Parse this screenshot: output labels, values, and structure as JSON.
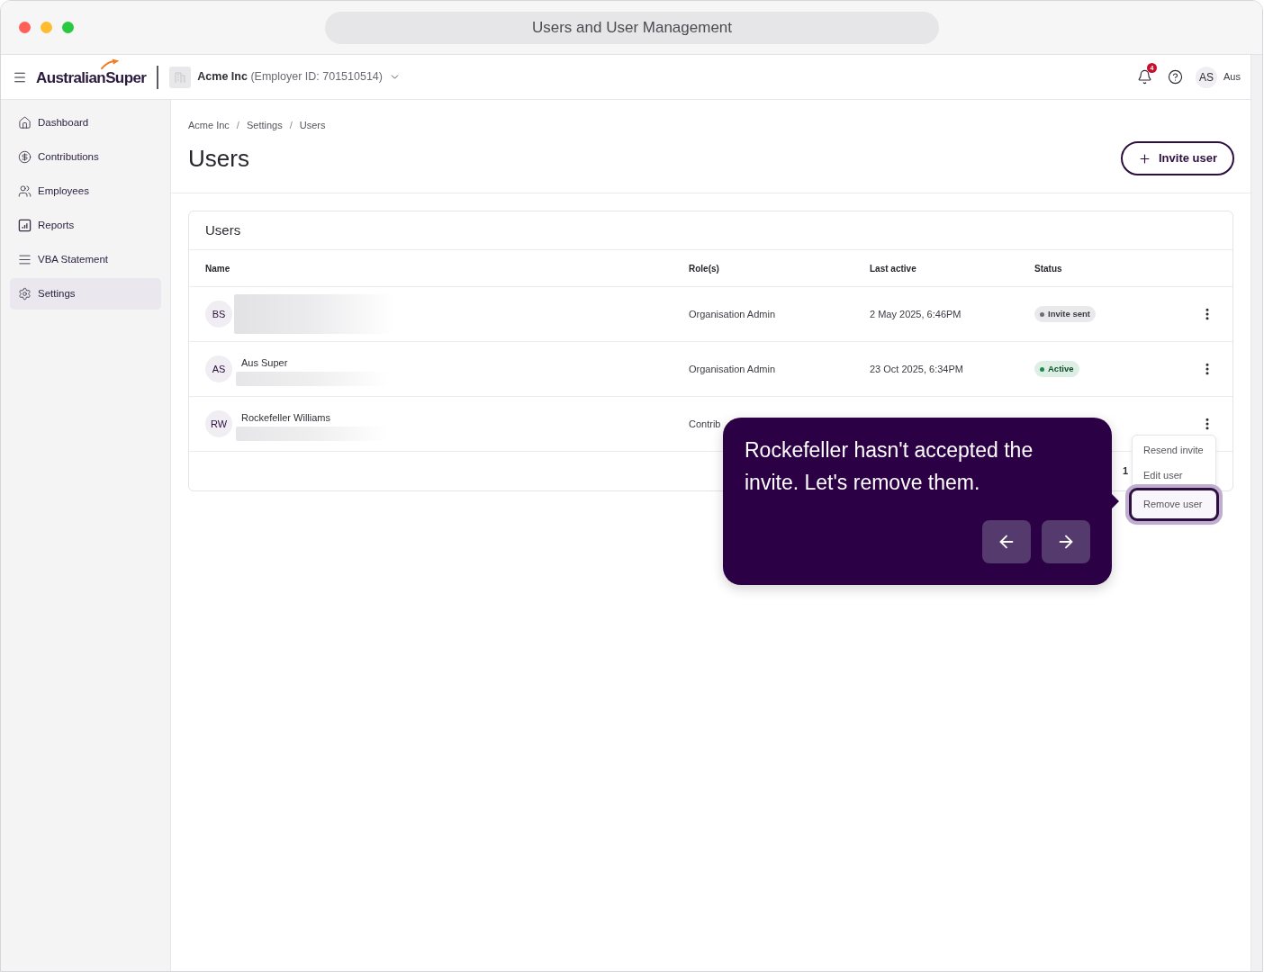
{
  "window": {
    "title": "Users and User Management"
  },
  "header": {
    "brand": "AustralianSuper",
    "organisation": "**Acme Inc** (Employer ID: 701510514)",
    "notifications": {
      "count": "4"
    },
    "user": {
      "initials": "AS",
      "name": "Aus"
    }
  },
  "sidebar": {
    "items": [
      {
        "label": "Dashboard",
        "selected": false
      },
      {
        "label": "Contributions",
        "selected": false
      },
      {
        "label": "Employees",
        "selected": false
      },
      {
        "label": "Reports",
        "selected": false
      },
      {
        "label": "VBA Statement",
        "selected": false
      },
      {
        "label": "Settings",
        "selected": true
      }
    ]
  },
  "page": {
    "breadcrumb": [
      {
        "label": "Acme Inc",
        "separator": "/"
      },
      {
        "label": "Settings",
        "separator": "/"
      },
      {
        "label": "Users"
      }
    ],
    "title": "Users",
    "invite_button": "Invite user"
  },
  "users_table": {
    "title": "Users",
    "columns": [
      "Name",
      "Role(s)",
      "Last active",
      "Status"
    ],
    "rows": [
      {
        "initials": "BS",
        "name_blurred": true,
        "role": "Organisation Admin",
        "last_active": "2 May 2025, 6:46PM",
        "status": {
          "label": "Invite sent",
          "color": "#6e6e78"
        }
      },
      {
        "initials": "AS",
        "name": "Aus Super",
        "email_blurred": true,
        "role": "Organisation Admin",
        "last_active": "23 Oct 2025, 6:34PM",
        "status": {
          "label": "Active",
          "color": "#1e8a4a"
        }
      },
      {
        "initials": "RW",
        "name": "Rockefeller Williams",
        "email_blurred": true,
        "role": "Contrib",
        "menu_open": true
      }
    ],
    "pagination": "1"
  },
  "row_menu": {
    "items": [
      {
        "label": "Resend invite",
        "highlighted": false
      },
      {
        "label": "Edit user",
        "highlighted": false
      },
      {
        "label": "Remove user",
        "highlighted": true
      }
    ]
  },
  "tour_tooltip": {
    "text": "Rockefeller hasn't accepted the invite. Let's remove them."
  }
}
